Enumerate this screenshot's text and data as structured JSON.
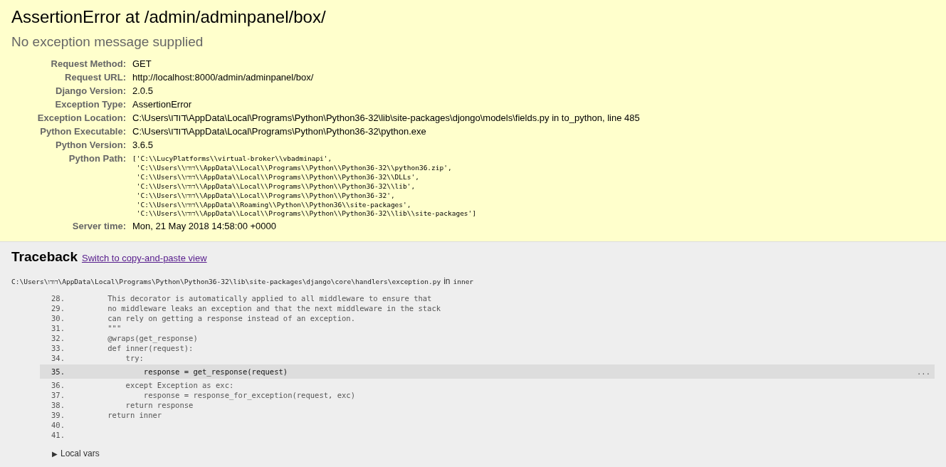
{
  "summary": {
    "title": "AssertionError at /admin/adminpanel/box/",
    "message": "No exception message supplied",
    "meta": [
      {
        "label": "Request Method:",
        "value": "GET",
        "kind": "text"
      },
      {
        "label": "Request URL:",
        "value": "http://localhost:8000/admin/adminpanel/box/",
        "kind": "text"
      },
      {
        "label": "Django Version:",
        "value": "2.0.5",
        "kind": "text"
      },
      {
        "label": "Exception Type:",
        "value": "AssertionError",
        "kind": "text"
      },
      {
        "label": "Exception Location:",
        "value": "C:\\Users\\דודו\\AppData\\Local\\Programs\\Python\\Python36-32\\lib\\site-packages\\djongo\\models\\fields.py in to_python, line 485",
        "kind": "text"
      },
      {
        "label": "Python Executable:",
        "value": "C:\\Users\\דודו\\AppData\\Local\\Programs\\Python\\Python36-32\\python.exe",
        "kind": "text"
      },
      {
        "label": "Python Version:",
        "value": "3.6.5",
        "kind": "text"
      },
      {
        "label": "Python Path:",
        "value": "['C:\\\\LucyPlatforms\\\\virtual-broker\\\\vbadminapi',\n 'C:\\\\Users\\\\דודו\\\\AppData\\\\Local\\\\Programs\\\\Python\\\\Python36-32\\\\python36.zip',\n 'C:\\\\Users\\\\דודו\\\\AppData\\\\Local\\\\Programs\\\\Python\\\\Python36-32\\\\DLLs',\n 'C:\\\\Users\\\\דודו\\\\AppData\\\\Local\\\\Programs\\\\Python\\\\Python36-32\\\\lib',\n 'C:\\\\Users\\\\דודו\\\\AppData\\\\Local\\\\Programs\\\\Python\\\\Python36-32',\n 'C:\\\\Users\\\\דודו\\\\AppData\\\\Roaming\\\\Python\\\\Python36\\\\site-packages',\n 'C:\\\\Users\\\\דודו\\\\AppData\\\\Local\\\\Programs\\\\Python\\\\Python36-32\\\\lib\\\\site-packages']",
        "kind": "code"
      },
      {
        "label": "Server time:",
        "value": "Mon, 21 May 2018 14:58:00 +0000",
        "kind": "text"
      }
    ]
  },
  "traceback": {
    "title": "Traceback",
    "switch_link": "Switch to copy-and-paste view",
    "frame": {
      "file": "C:\\Users\\דודו\\AppData\\Local\\Programs\\Python\\Python36-32\\lib\\site-packages\\django\\core\\handlers\\exception.py",
      "in_word": "in",
      "function": "inner",
      "lines": [
        {
          "number": "28.",
          "code": "    This decorator is automatically applied to all middleware to ensure that",
          "selected": false
        },
        {
          "number": "29.",
          "code": "    no middleware leaks an exception and that the next middleware in the stack",
          "selected": false
        },
        {
          "number": "30.",
          "code": "    can rely on getting a response instead of an exception.",
          "selected": false
        },
        {
          "number": "31.",
          "code": "    \"\"\"",
          "selected": false
        },
        {
          "number": "32.",
          "code": "    @wraps(get_response)",
          "selected": false
        },
        {
          "number": "33.",
          "code": "    def inner(request):",
          "selected": false
        },
        {
          "number": "34.",
          "code": "        try:",
          "selected": false
        },
        {
          "number": "35.",
          "code": "            response = get_response(request)",
          "selected": true,
          "more": "..."
        },
        {
          "number": "36.",
          "code": "        except Exception as exc:",
          "selected": false
        },
        {
          "number": "37.",
          "code": "            response = response_for_exception(request, exc)",
          "selected": false
        },
        {
          "number": "38.",
          "code": "        return response",
          "selected": false
        },
        {
          "number": "39.",
          "code": "    return inner",
          "selected": false
        },
        {
          "number": "40.",
          "selected": false
        },
        {
          "number": "41.",
          "selected": false
        }
      ],
      "local_vars": {
        "toggle": "▶",
        "label": "Local vars",
        "expanded": false
      }
    }
  }
}
